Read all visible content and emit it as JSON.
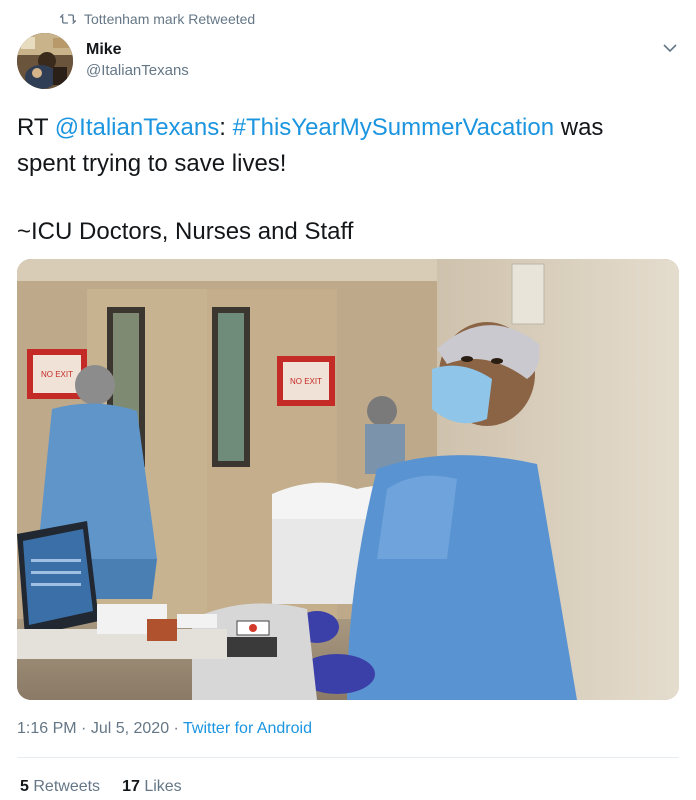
{
  "retweet_context": {
    "icon": "retweet-icon",
    "text": "Tottenham mark Retweeted"
  },
  "author": {
    "name": "Mike",
    "handle": "@ItalianTexans"
  },
  "tweet": {
    "line1_prefix": "RT ",
    "mention": "@ItalianTexans",
    "colon": ": ",
    "hashtag": "#ThisYearMySummerVacation",
    "line1_suffix": " was",
    "line2": "spent trying to save lives!",
    "signature": "~ICU Doctors, Nurses and Staff"
  },
  "photo": {
    "sign_text_1": "NO EXIT",
    "sign_text_2": "NO EXIT"
  },
  "meta": {
    "time": "1:16 PM",
    "separator": " · ",
    "date": "Jul 5, 2020",
    "separator2": " · ",
    "source": "Twitter for Android"
  },
  "stats": {
    "retweet_count": "5",
    "retweet_label": "Retweets",
    "like_count": "17",
    "like_label": "Likes"
  },
  "colors": {
    "link": "#1b95e0",
    "muted": "#657786",
    "text": "#14171a"
  }
}
